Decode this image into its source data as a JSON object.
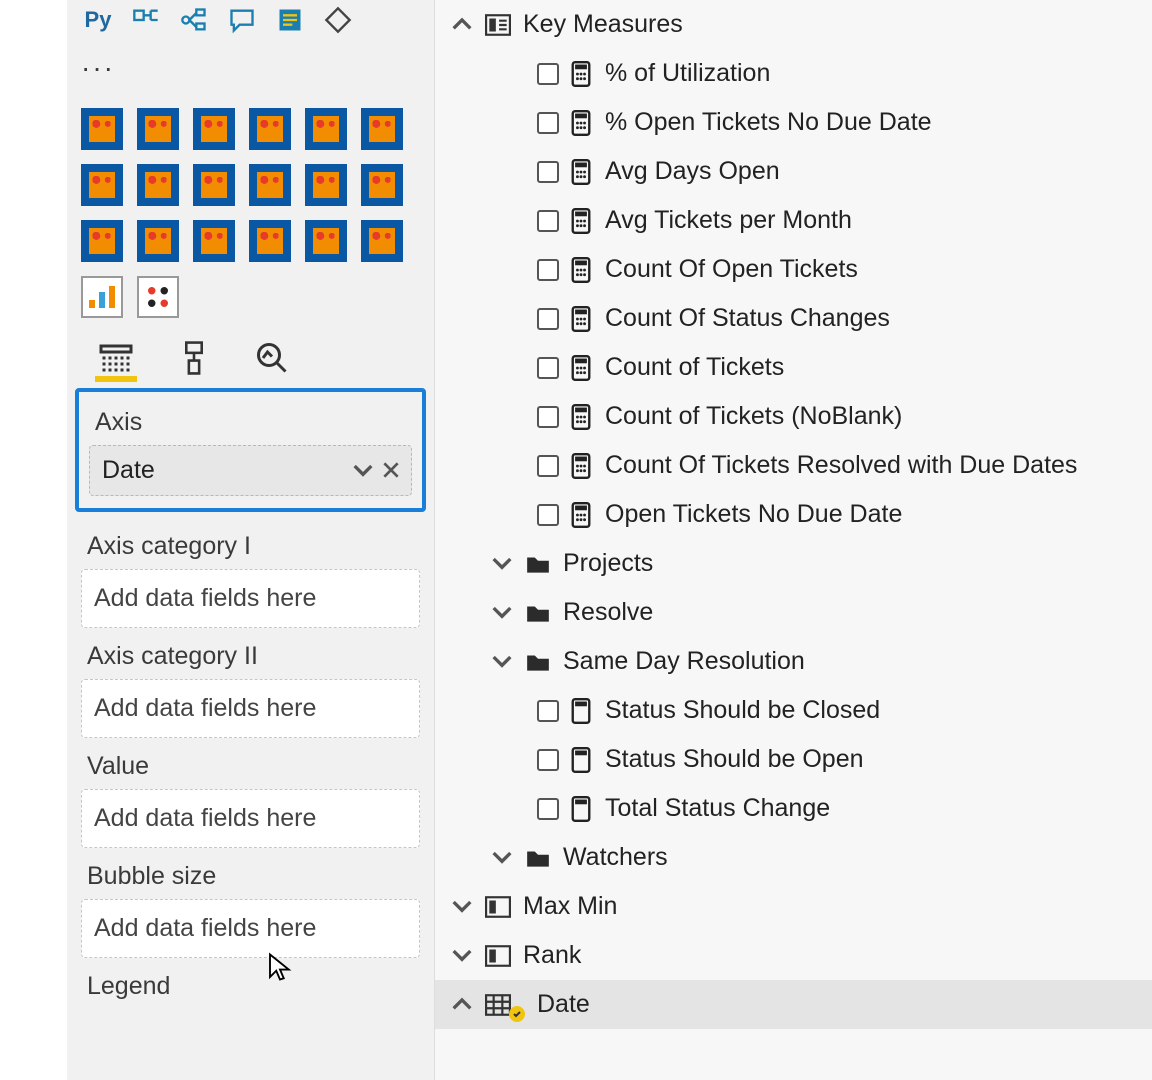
{
  "viz_panel": {
    "py_label": "Py",
    "ellipsis": "···",
    "tabs": {
      "fields": "Fields",
      "format": "Format",
      "analytics": "Analytics"
    }
  },
  "wells": {
    "axis": {
      "label": "Axis",
      "chip": "Date"
    },
    "axis_cat1": {
      "label": "Axis category I",
      "placeholder": "Add data fields here"
    },
    "axis_cat2": {
      "label": "Axis category II",
      "placeholder": "Add data fields here"
    },
    "value": {
      "label": "Value",
      "placeholder": "Add data fields here"
    },
    "bubble": {
      "label": "Bubble size",
      "placeholder": "Add data fields here"
    },
    "legend": {
      "label": "Legend"
    }
  },
  "fields": {
    "key_measures": {
      "name": "Key Measures",
      "items": [
        "% of Utilization",
        "% Open Tickets No Due Date",
        "Avg Days Open",
        "Avg Tickets per Month",
        "Count Of Open Tickets",
        "Count Of Status Changes",
        "Count of Tickets",
        "Count of Tickets (NoBlank)",
        "Count Of Tickets Resolved with Due Dates",
        "Open Tickets No Due Date"
      ]
    },
    "folders": [
      {
        "name": "Projects"
      },
      {
        "name": "Resolve"
      },
      {
        "name": "Same Day Resolution"
      }
    ],
    "after_sameday": [
      "Status Should be Closed",
      "Status Should be Open",
      "Total Status Change"
    ],
    "watchers": "Watchers",
    "tables": [
      {
        "name": "Max Min"
      },
      {
        "name": "Rank"
      },
      {
        "name": "Date",
        "expanded": true,
        "selected": true
      }
    ]
  }
}
